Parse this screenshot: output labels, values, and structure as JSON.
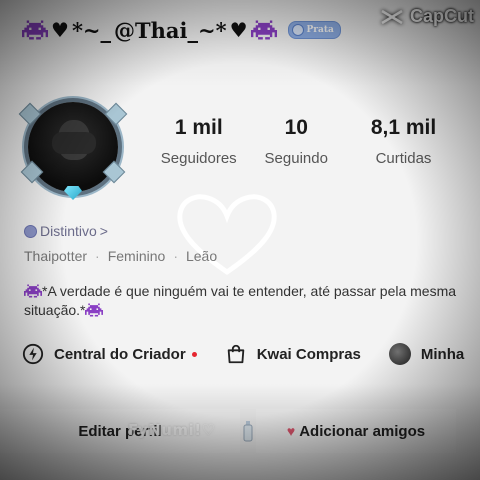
{
  "header": {
    "username_prefix": "*~_",
    "username": "@Thai_~*",
    "badge_label": "Prata",
    "watermark": "CapCut"
  },
  "stats": [
    {
      "value": "1 mil",
      "label": "Seguidores"
    },
    {
      "value": "10",
      "label": "Seguindo"
    },
    {
      "value": "8,1 mil",
      "label": "Curtidas"
    }
  ],
  "profile": {
    "distintivo": "Distintivo",
    "distintivo_chevron": ">",
    "tags": [
      "Thaipotter",
      "Feminino",
      "Leão"
    ],
    "bio": "*A verdade é que ninguém vai te entender, até passar pela mesma situação.*"
  },
  "shortcuts": [
    {
      "label": "Central do Criador",
      "icon": "lightning-circle-icon"
    },
    {
      "label": "Kwai Compras",
      "icon": "shopping-bag-icon"
    },
    {
      "label": "Minha",
      "icon": "avatar-icon"
    }
  ],
  "actions": {
    "edit_label": "Editar perfil",
    "overlay_text": "FyNumi!♡",
    "add_friends_label": "Adicionar amigos"
  },
  "colors": {
    "invader": "#8a3fc4",
    "badge": "#8fb0e8",
    "red_dot": "#e5262f",
    "heart_pink": "#e0566e"
  }
}
